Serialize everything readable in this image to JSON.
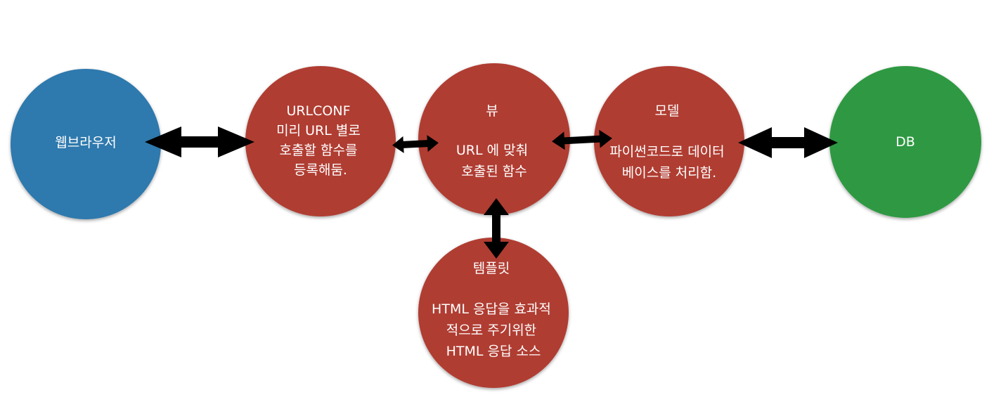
{
  "colors": {
    "browser": "#2f79ad",
    "component": "#b03d33",
    "db": "#2f9942",
    "arrow": "#000000",
    "text": "#ffffff"
  },
  "nodes": {
    "browser": {
      "lines": [
        "웹브라우저"
      ]
    },
    "urlconf": {
      "lines": [
        "URLCONF",
        "미리 URL 별로",
        "호출할 함수를",
        "등록해둠."
      ]
    },
    "view": {
      "lines": [
        "뷰",
        "",
        "URL 에 맞춰",
        "호출된 함수"
      ]
    },
    "model": {
      "lines": [
        "모델",
        "",
        "파이썬코드로 데이터",
        "베이스를 처리함."
      ]
    },
    "db": {
      "lines": [
        "DB"
      ]
    },
    "template": {
      "lines": [
        "템플릿",
        "",
        "HTML 응답을 효과적",
        "적으로 주기위한",
        "HTML 응답 소스"
      ]
    }
  },
  "edges": [
    {
      "from": "browser",
      "to": "urlconf",
      "direction": "both"
    },
    {
      "from": "urlconf",
      "to": "view",
      "direction": "both"
    },
    {
      "from": "view",
      "to": "model",
      "direction": "both"
    },
    {
      "from": "model",
      "to": "db",
      "direction": "both"
    },
    {
      "from": "view",
      "to": "template",
      "direction": "both"
    }
  ]
}
